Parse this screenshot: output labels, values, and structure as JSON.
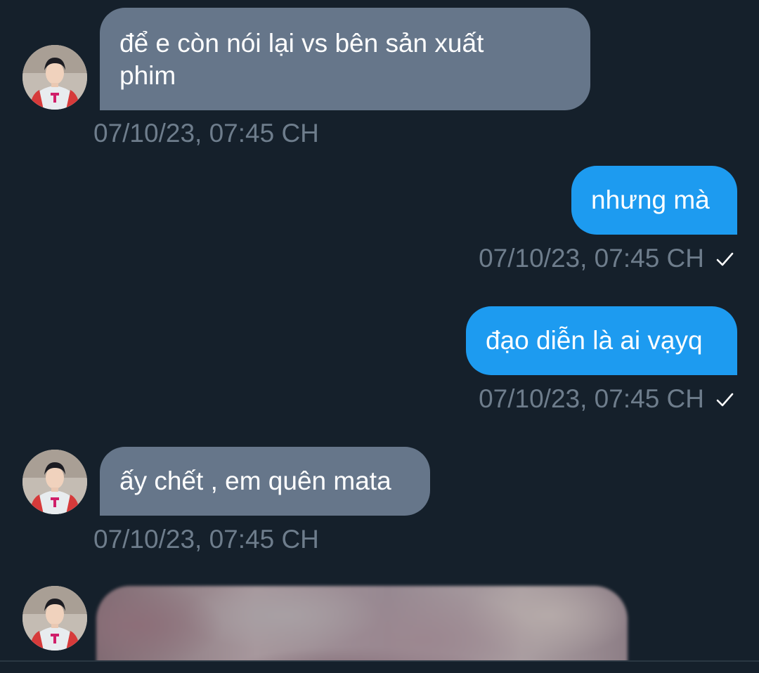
{
  "conversation": {
    "messages": [
      {
        "direction": "received",
        "text": "để e còn nói lại vs bên sản xuất\nphim",
        "timestamp": "07/10/23, 07:45 CH"
      },
      {
        "direction": "sent",
        "text": "nhưng mà",
        "timestamp": "07/10/23, 07:45 CH",
        "status": "sent-check-icon"
      },
      {
        "direction": "sent",
        "text": "đạo diễn là ai vạyq",
        "timestamp": "07/10/23, 07:45 CH",
        "status": "sent-check-icon"
      },
      {
        "direction": "received",
        "text": "ấy chết , em quên mata",
        "timestamp": "07/10/23, 07:45 CH"
      },
      {
        "direction": "received",
        "media": "blurred-image"
      }
    ]
  },
  "colors": {
    "background": "#15202b",
    "received_bubble": "#66768a",
    "sent_bubble": "#1d9bf0",
    "timestamp": "#6e7d8c"
  }
}
